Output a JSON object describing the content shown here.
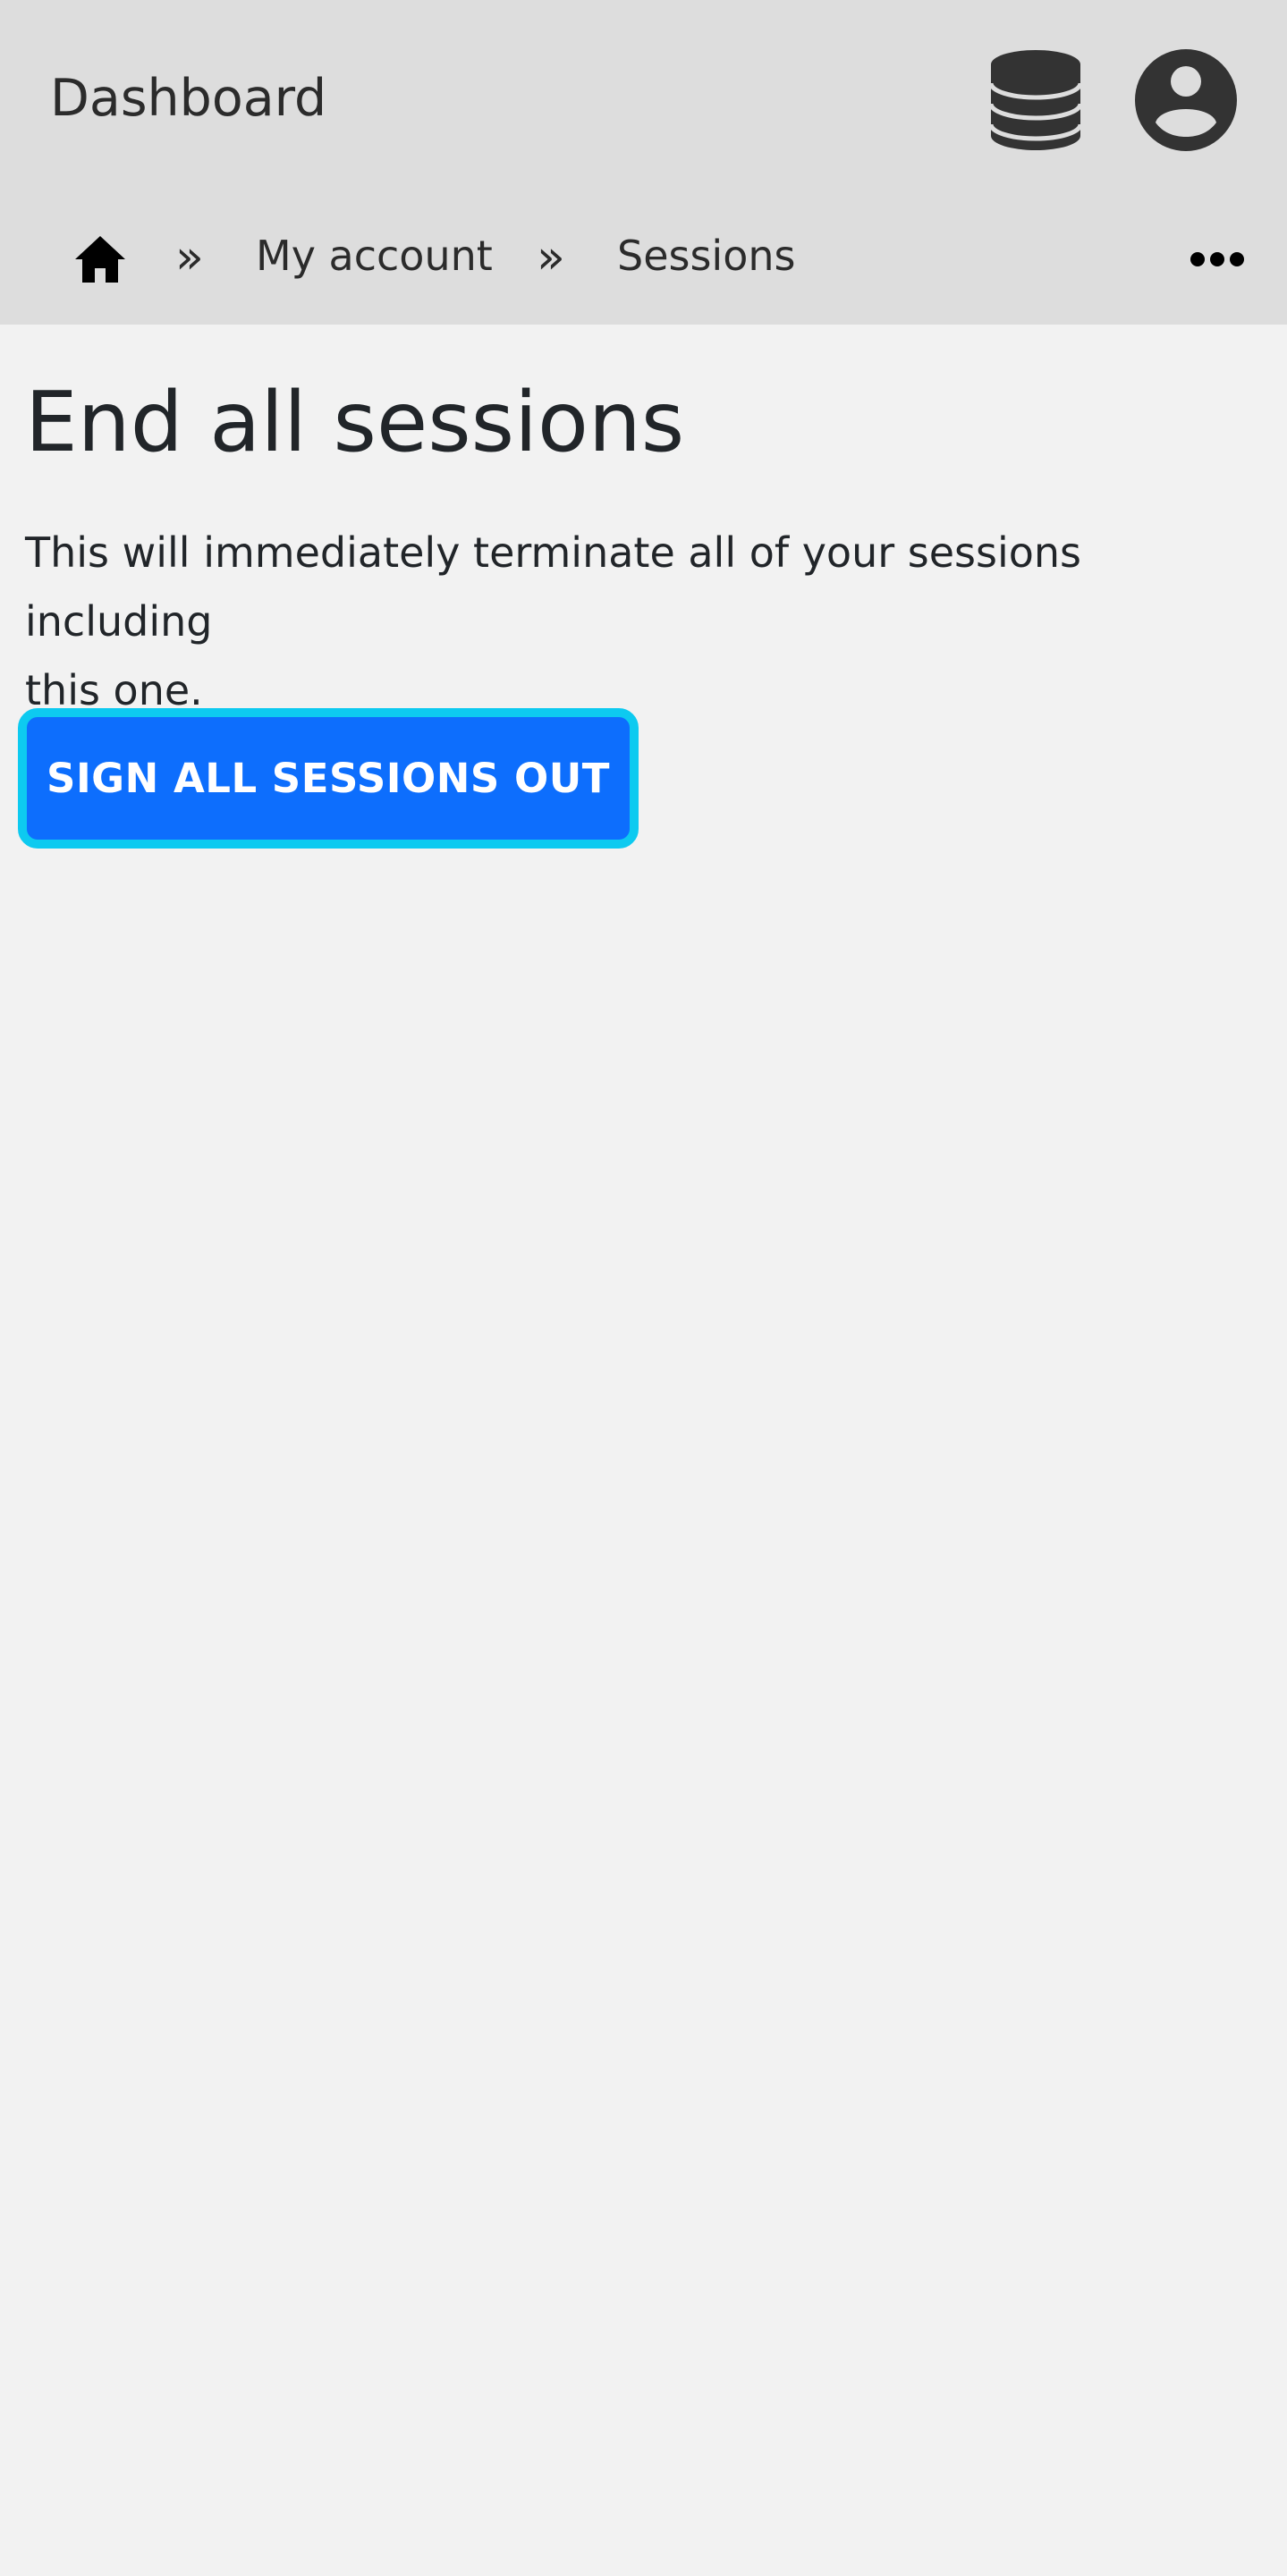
{
  "header": {
    "title": "Dashboard",
    "icons": [
      "database-icon",
      "user-circle-icon"
    ]
  },
  "breadcrumb": {
    "home_icon": "home-icon",
    "separator": "»",
    "items": [
      {
        "label": "My account"
      },
      {
        "label": "Sessions"
      }
    ],
    "more_icon": "ellipsis-icon"
  },
  "main": {
    "title": "End all sessions",
    "description_line1": "This will immediately terminate all of your sessions including",
    "description_line2": "this one.",
    "button_label": "SIGN ALL SESSIONS OUT"
  },
  "colors": {
    "header_bg": "#dddddd",
    "page_bg": "#f2f2f2",
    "button_bg": "#0d6efd",
    "button_focus_ring": "#0dcaf0",
    "icon_dark": "#333333"
  }
}
